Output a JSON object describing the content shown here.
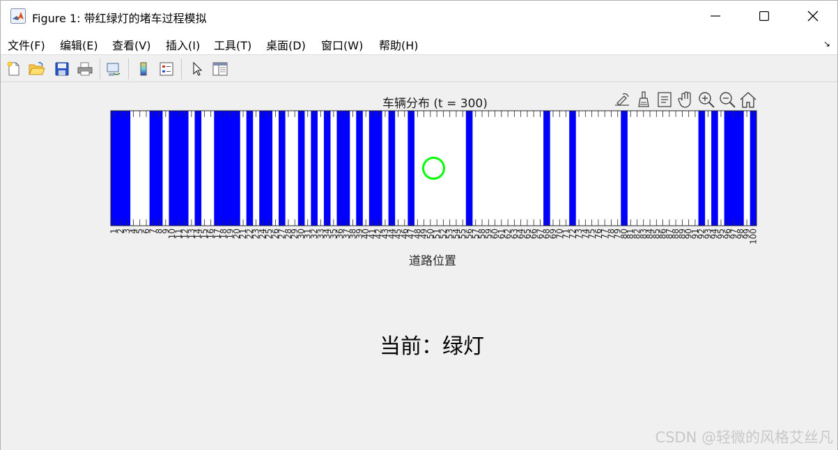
{
  "window": {
    "title": "Figure 1: 带红绿灯的堵车过程模拟",
    "minimize_icon": "minimize-icon",
    "maximize_icon": "maximize-icon",
    "close_icon": "close-icon"
  },
  "menubar": {
    "items": [
      "文件(F)",
      "编辑(E)",
      "查看(V)",
      "插入(I)",
      "工具(T)",
      "桌面(D)",
      "窗口(W)",
      "帮助(H)"
    ],
    "overflow": "↘"
  },
  "toolbar": {
    "buttons": [
      "new-figure-icon",
      "open-file-icon",
      "save-icon",
      "print-icon",
      "link-plot-icon",
      "colorbar-icon",
      "legend-icon",
      "pointer-icon",
      "property-editor-icon"
    ]
  },
  "axes_toolbar": {
    "buttons": [
      "export-icon",
      "brush-icon",
      "data-tips-icon",
      "pan-icon",
      "zoom-in-icon",
      "zoom-out-icon",
      "home-icon"
    ]
  },
  "chart_data": {
    "type": "bar",
    "title": "车辆分布 (t = 300)",
    "xlabel": "道路位置",
    "ylabel": "",
    "xlim": [
      1,
      100
    ],
    "ylim": [
      0,
      1
    ],
    "occupied_positions": [
      1,
      2,
      3,
      7,
      8,
      10,
      11,
      12,
      14,
      17,
      18,
      19,
      20,
      22,
      24,
      25,
      27,
      30,
      32,
      34,
      36,
      37,
      39,
      41,
      42,
      44,
      47,
      56,
      68,
      72,
      80,
      92,
      94,
      96,
      97,
      98,
      100
    ],
    "tick_labels": [
      "1",
      "2",
      "3",
      "4",
      "5",
      "6",
      "7",
      "8",
      "9",
      "10",
      "11",
      "12",
      "13",
      "14",
      "15",
      "16",
      "17",
      "18",
      "19",
      "20",
      "21",
      "22",
      "23",
      "24",
      "25",
      "26",
      "27",
      "28",
      "29",
      "30",
      "31",
      "32",
      "33",
      "34",
      "35",
      "36",
      "37",
      "38",
      "39",
      "40",
      "41",
      "42",
      "43",
      "44",
      "45",
      "46",
      "47",
      "48",
      "49",
      "50",
      "51",
      "52",
      "53",
      "54",
      "55",
      "56",
      "57",
      "58",
      "59",
      "60",
      "61",
      "62",
      "63",
      "64",
      "65",
      "66",
      "67",
      "68",
      "69",
      "70",
      "71",
      "72",
      "73",
      "74",
      "75",
      "76",
      "77",
      "78",
      "79",
      "80",
      "81",
      "82",
      "83",
      "84",
      "85",
      "86",
      "87",
      "88",
      "89",
      "90",
      "91",
      "92",
      "93",
      "94",
      "95",
      "96",
      "97",
      "98",
      "99",
      "100"
    ],
    "vehicle_color": "#0000ff",
    "traffic_light": {
      "position": 50.5,
      "color": "#00ff00"
    },
    "grid": false
  },
  "status": {
    "text": "当前：绿灯"
  },
  "watermark": "CSDN @轻微的风格艾丝凡"
}
